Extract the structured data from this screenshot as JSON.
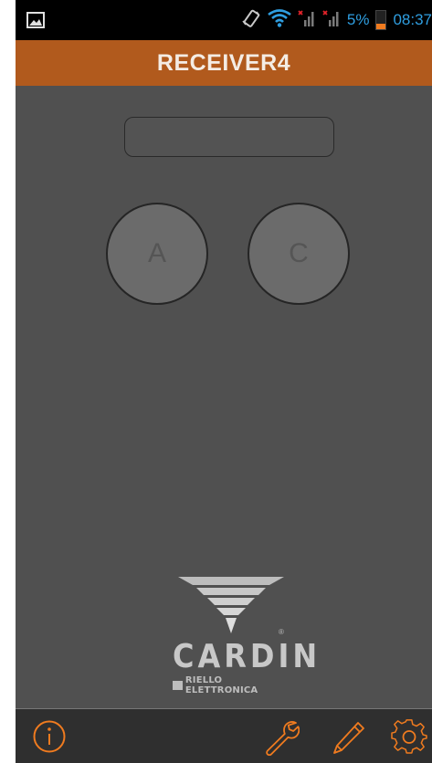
{
  "status_bar": {
    "battery_percent": "5%",
    "time": "08:37",
    "icons": [
      "gallery-icon",
      "vibrate-icon",
      "wifi-icon",
      "signal-x-icon",
      "signal-x-icon",
      "battery-icon"
    ],
    "accent_color": "#2f9ee0"
  },
  "header": {
    "title": "RECEIVER4",
    "color": "#b15a1d"
  },
  "display": {
    "value": ""
  },
  "channels": [
    {
      "label": "A"
    },
    {
      "label": "C"
    }
  ],
  "logo": {
    "wordmark": "CARDIN",
    "registered": "®",
    "subtitle": "RIELLO ELETTRONICA"
  },
  "bottom_bar": {
    "icons": [
      "info-icon",
      "wrench-icon",
      "pencil-icon",
      "gear-icon"
    ],
    "accent_color": "#f07b1f"
  }
}
